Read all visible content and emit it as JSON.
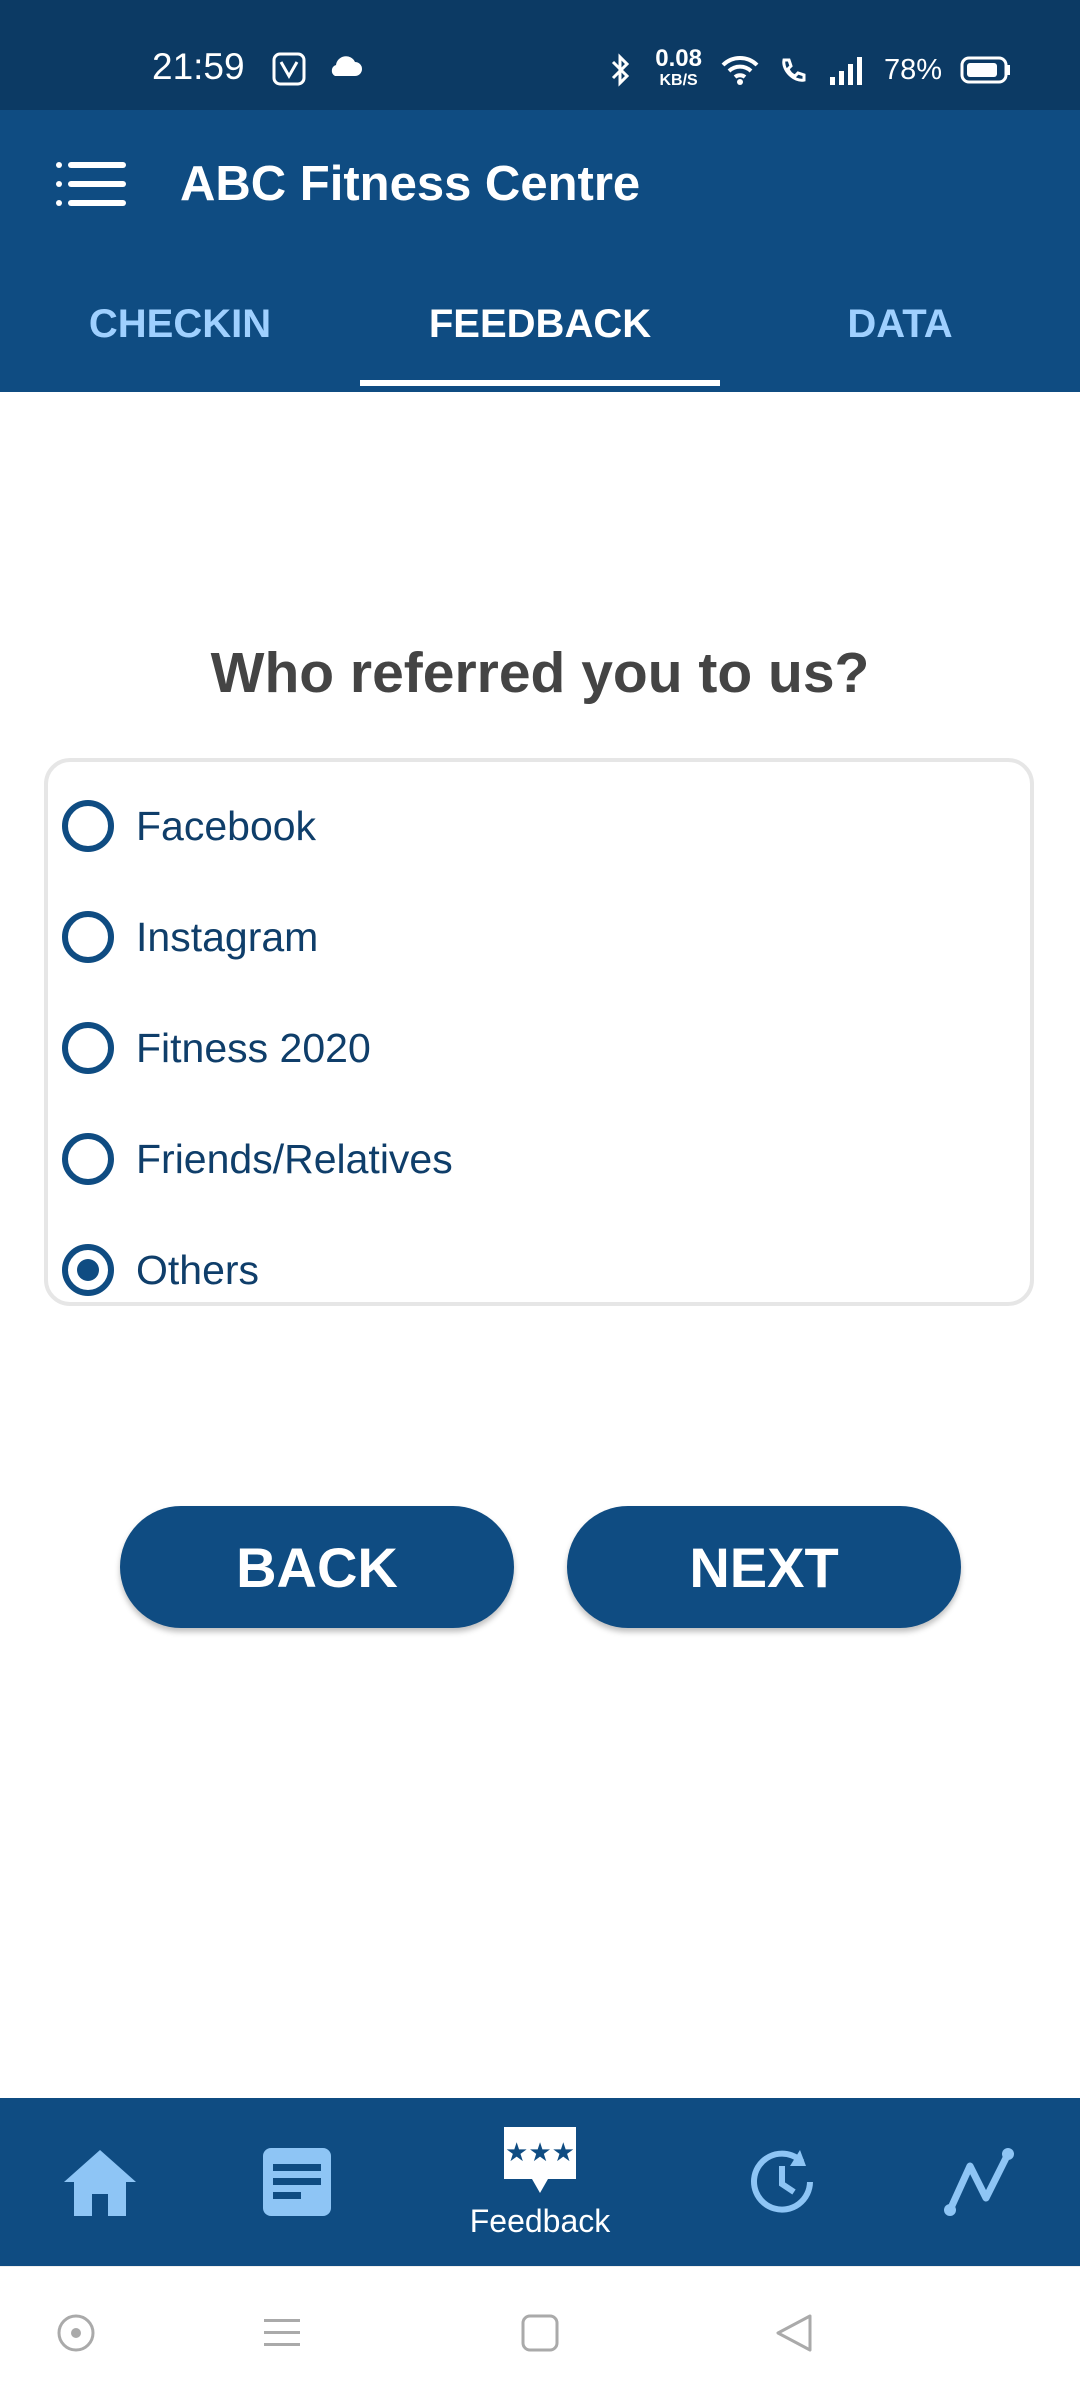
{
  "status_bar": {
    "time": "21:59",
    "net_speed_value": "0.08",
    "net_speed_unit": "KB/S",
    "battery": "78%"
  },
  "app_bar": {
    "title": "ABC Fitness Centre"
  },
  "tabs": [
    {
      "label": "CHECKIN",
      "active": false
    },
    {
      "label": "FEEDBACK",
      "active": true
    },
    {
      "label": "DATA",
      "active": false
    }
  ],
  "question": "Who referred you to us?",
  "options": [
    {
      "label": "Facebook",
      "selected": false
    },
    {
      "label": "Instagram",
      "selected": false
    },
    {
      "label": "Fitness 2020",
      "selected": false
    },
    {
      "label": "Friends/Relatives",
      "selected": false
    },
    {
      "label": "Others",
      "selected": true
    }
  ],
  "buttons": {
    "back": "BACK",
    "next": "NEXT"
  },
  "bottom_nav": {
    "items": [
      {
        "icon": "home-icon"
      },
      {
        "icon": "list-icon"
      },
      {
        "icon": "feedback-icon",
        "label": "Feedback",
        "active": true
      },
      {
        "icon": "history-icon"
      },
      {
        "icon": "chart-icon"
      }
    ]
  },
  "colors": {
    "primary": "#0f4c82",
    "status_bar": "#0c3a64",
    "tab_inactive": "#9fd0ff",
    "accent_light": "#8ec5f5"
  }
}
